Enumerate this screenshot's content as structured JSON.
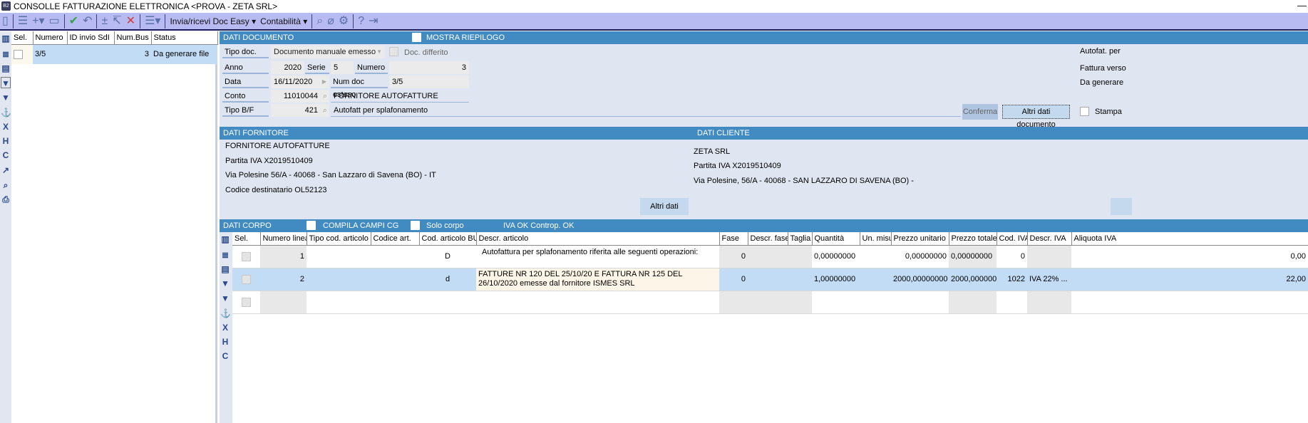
{
  "window": {
    "title": "CONSOLLE FATTURAZIONE ELETTRONICA <PROVA - ZETA SRL>",
    "logo": "B2",
    "minimize": "—"
  },
  "toolbar": {
    "invia": "Invia/ricevi Doc Easy ▾",
    "contabilita": "Contabilità ▾"
  },
  "list": {
    "headers": [
      "Sel.",
      "Numero",
      "ID invio SdI",
      "Num.Bus",
      "Status"
    ],
    "rows": [
      {
        "numero": "3/5",
        "id": "",
        "numbus": "3",
        "status": "Da generare file"
      }
    ]
  },
  "dati_documento": {
    "title": "DATI DOCUMENTO",
    "mostra_riepilogo": "MOSTRA RIEPILOGO",
    "tipo_doc_label": "Tipo doc.",
    "tipo_doc": "Documento manuale emesso",
    "doc_differito": "Doc. differito",
    "anno_label": "Anno",
    "anno": "2020",
    "serie_label": "Serie",
    "serie": "5",
    "numero_label": "Numero",
    "numero": "3",
    "data_label": "Data",
    "data": "16/11/2020",
    "num_doc_esteso_label": "Num doc esteso",
    "num_doc_esteso": "3/5",
    "conto_label": "Conto",
    "conto": "11010044",
    "conto_desc": "FORNITORE AUTOFATTURE",
    "tipo_bf_label": "Tipo B/F",
    "tipo_bf": "421",
    "tipo_bf_desc": "Autofatt per splafonamento",
    "side": [
      "Autofat. per",
      "Fattura verso",
      "Da generare"
    ],
    "conferma": "Conferma",
    "altri_dati_documento": "Altri dati documento",
    "stampa": "Stampa"
  },
  "dati_fornitore": {
    "title": "DATI FORNITORE",
    "lines": [
      "FORNITORE AUTOFATTURE",
      "Partita IVA X2019510409",
      "Via  Polesine 56/A - 40068 - San Lazzaro di Savena (BO)  - IT",
      "Codice destinatario OL52123"
    ],
    "altri_dati": "Altri dati"
  },
  "dati_cliente": {
    "title": "DATI CLIENTE",
    "lines": [
      "ZETA SRL",
      "Partita IVA X2019510409",
      "Via Polesine, 56/A - 40068 - SAN LAZZARO DI SAVENA (BO)  -"
    ]
  },
  "dati_corpo": {
    "title": "DATI CORPO",
    "compila": "COMPILA CAMPI CG",
    "solo_corpo": "Solo corpo",
    "iva_ok": "IVA OK Controp. OK",
    "headers": [
      "Sel.",
      "Numero linea",
      "Tipo cod. articolo",
      "Codice art.",
      "Cod. articolo BUS",
      "Descr. articolo",
      "Fase",
      "Descr. fase",
      "Taglia",
      "Quantità",
      "Un. misura",
      "Prezzo unitario",
      "Prezzo totale",
      "Cod. IVA",
      "Descr. IVA",
      "Aliquota IVA"
    ],
    "rows": [
      [
        "",
        "1",
        "",
        "",
        "D",
        "Autofattura per splafonamento riferita alle seguenti operazioni:",
        "0",
        "",
        "",
        "0,00000000",
        "",
        "0,00000000",
        "0,00000000",
        "0",
        "",
        "0,00"
      ],
      [
        "",
        "2",
        "",
        "",
        "d",
        "FATTURE NR 120 DEL 25/10/20 E FATTURA NR 125 DEL 26/10/2020 emesse dal fornitore ISMES SRL",
        "0",
        "",
        "",
        "1,00000000",
        "",
        "2000,00000000",
        "2000,000000...",
        "1022",
        "IVA 22% ...",
        "22,00"
      ],
      [
        "",
        "",
        "",
        "",
        "",
        "",
        "",
        "",
        "",
        "",
        "",
        "",
        "",
        "",
        "",
        ""
      ]
    ]
  }
}
